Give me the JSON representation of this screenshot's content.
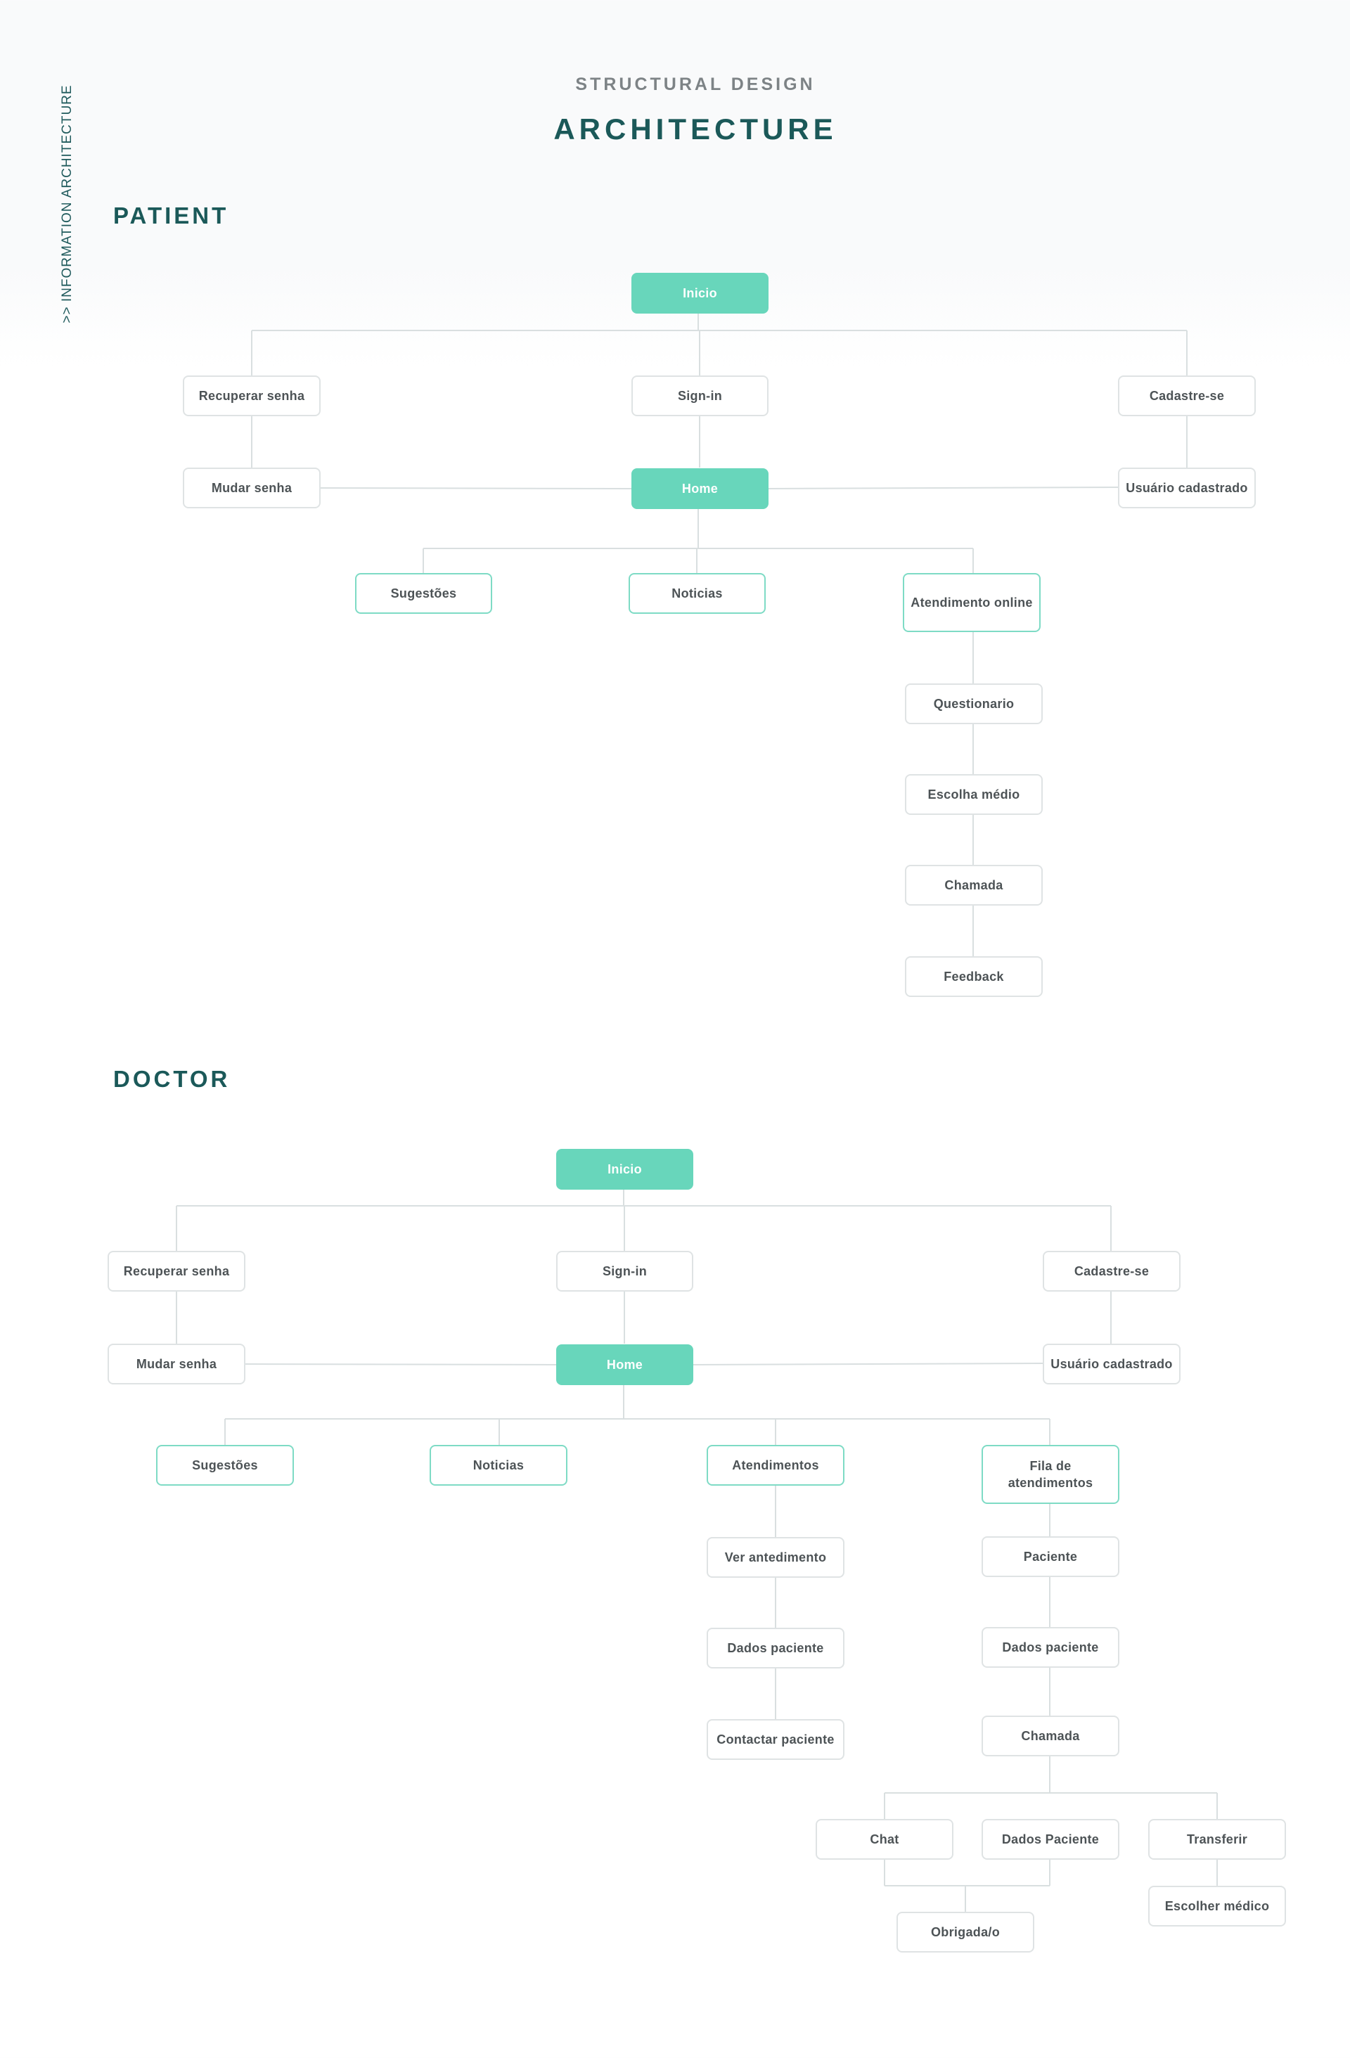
{
  "sidebar": {
    "label": ">> INFORMATION ARCHITECTURE"
  },
  "header": {
    "eyebrow": "STRUCTURAL DESIGN",
    "title": "ARCHITECTURE"
  },
  "patient": {
    "title": "PATIENT",
    "nodes": {
      "inicio": "Inicio",
      "recuperar": "Recuperar senha",
      "signin": "Sign-in",
      "cadastre": "Cadastre-se",
      "mudar": "Mudar senha",
      "home": "Home",
      "usuario": "Usuário cadastrado",
      "sugestoes": "Sugestões",
      "noticias": "Noticias",
      "atendimento": "Atendimento online",
      "questionario": "Questionario",
      "escolha": "Escolha médio",
      "chamada": "Chamada",
      "feedback": "Feedback"
    }
  },
  "doctor": {
    "title": "DOCTOR",
    "nodes": {
      "inicio": "Inicio",
      "recuperar": "Recuperar senha",
      "signin": "Sign-in",
      "cadastre": "Cadastre-se",
      "mudar": "Mudar senha",
      "home": "Home",
      "usuario": "Usuário cadastrado",
      "sugestoes": "Sugestões",
      "noticias": "Noticias",
      "atendimentos": "Atendimentos",
      "fila": "Fila de atendimentos",
      "ver": "Ver antedimento",
      "dados1": "Dados paciente",
      "contactar": "Contactar paciente",
      "paciente": "Paciente",
      "dados2": "Dados paciente",
      "chamada": "Chamada",
      "chat": "Chat",
      "dadosP": "Dados Paciente",
      "transferir": "Transferir",
      "obrigada": "Obrigada/o",
      "escolher": "Escolher médico"
    }
  },
  "colors": {
    "primary": "#68d6bb",
    "accent_border": "#7edbc5",
    "title": "#1b5959",
    "eyebrow": "#7d8386",
    "line": "#d9dfe0",
    "node_text": "#4d5356"
  }
}
